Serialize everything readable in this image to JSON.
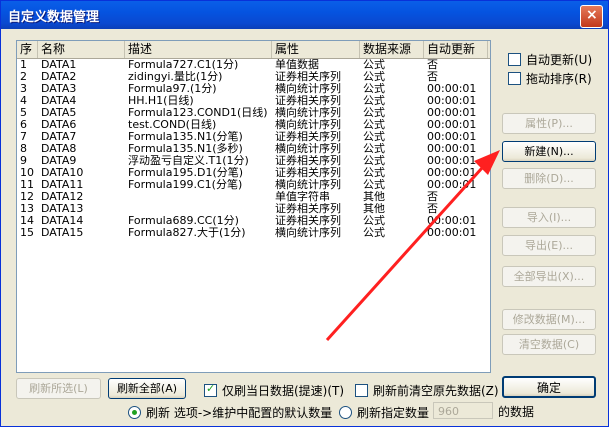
{
  "window": {
    "title": "自定义数据管理",
    "close_glyph": "×"
  },
  "list": {
    "columns": [
      "序",
      "名称",
      "描述",
      "属性",
      "数据来源",
      "自动更新"
    ],
    "rows": [
      [
        "1",
        "DATA1",
        "Formula727.C1(1分)",
        "单值数据",
        "公式",
        "否"
      ],
      [
        "2",
        "DATA2",
        "zidingyi.量比(1分)",
        "证券相关序列",
        "公式",
        "否"
      ],
      [
        "3",
        "DATA3",
        "Formula97.(1分)",
        "横向统计序列",
        "公式",
        "00:00:01"
      ],
      [
        "4",
        "DATA4",
        "HH.H1(日线)",
        "证券相关序列",
        "公式",
        "00:00:01"
      ],
      [
        "5",
        "DATA5",
        "Formula123.COND1(日线)",
        "横向统计序列",
        "公式",
        "00:00:01"
      ],
      [
        "6",
        "DATA6",
        "test.COND(日线)",
        "横向统计序列",
        "公式",
        "00:00:01"
      ],
      [
        "7",
        "DATA7",
        "Formula135.N1(分笔)",
        "证券相关序列",
        "公式",
        "00:00:01"
      ],
      [
        "8",
        "DATA8",
        "Formula135.N1(多秒)",
        "横向统计序列",
        "公式",
        "00:00:01"
      ],
      [
        "9",
        "DATA9",
        "浮动盈亏自定义.T1(1分)",
        "证券相关序列",
        "公式",
        "00:00:01"
      ],
      [
        "10",
        "DATA10",
        "Formula195.D1(分笔)",
        "证券相关序列",
        "公式",
        "00:00:01"
      ],
      [
        "11",
        "DATA11",
        "Formula199.C1(分笔)",
        "横向统计序列",
        "公式",
        "00:00:01"
      ],
      [
        "12",
        "DATA12",
        "",
        "单值字符串",
        "其他",
        "否"
      ],
      [
        "13",
        "DATA13",
        "",
        "证券相关序列",
        "其他",
        "否"
      ],
      [
        "14",
        "DATA14",
        "Formula689.CC(1分)",
        "证券相关序列",
        "公式",
        "00:00:01"
      ],
      [
        "15",
        "DATA15",
        "Formula827.大于(1分)",
        "横向统计序列",
        "公式",
        "00:00:01"
      ]
    ]
  },
  "options": {
    "auto_update": "自动更新(U)",
    "drag_sort": "拖动排序(R)"
  },
  "side_buttons": {
    "properties": "属性(P)...",
    "new": "新建(N)...",
    "delete": "删除(D)...",
    "import": "导入(I)...",
    "export": "导出(E)...",
    "export_all": "全部导出(X)...",
    "modify_data": "修改数据(M)...",
    "clear_data": "清空数据(C)"
  },
  "bottom": {
    "refresh_selected": "刷新所选(L)",
    "refresh_all": "刷新全部(A)",
    "refresh_today_only": "仅刷当日数据(提速)(T)",
    "clear_before_refresh": "刷新前清空原先数据(Z)",
    "ok": "确定",
    "radio_default": "刷新 选项->维护中配置的默认数量",
    "radio_specified": "刷新指定数量",
    "count_value": "960",
    "count_suffix": "的数据"
  },
  "colors": {
    "accent": "#0a5fe8",
    "arrow": "#ff2020"
  }
}
